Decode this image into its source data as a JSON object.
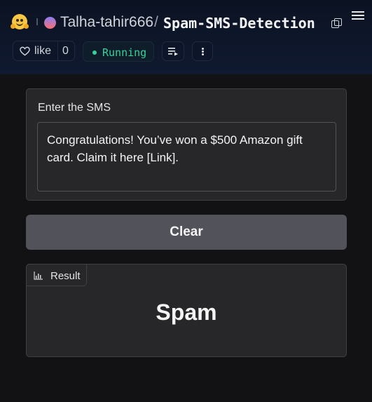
{
  "header": {
    "owner": "Talha-tahir666",
    "separator": "/",
    "repo": "Spam-SMS-Detection",
    "like_label": "like",
    "like_count": "0",
    "status": "Running"
  },
  "colors": {
    "status": "#34d399",
    "panel": "#27272a",
    "button": "#52525b"
  },
  "form": {
    "input_label": "Enter the SMS",
    "sms_value": "Congratulations! You’ve won a $500 Amazon gift card. Claim it here [Link].",
    "clear_label": "Clear"
  },
  "result": {
    "label": "Result",
    "value": "Spam"
  }
}
